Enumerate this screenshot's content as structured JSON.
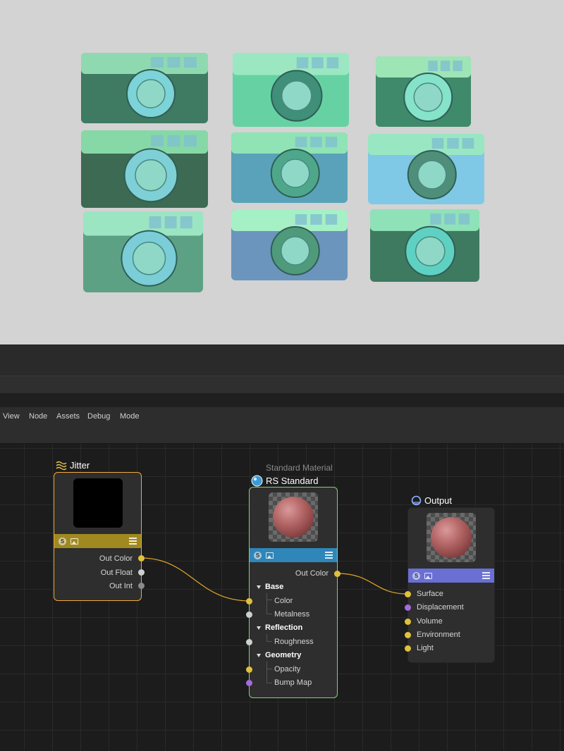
{
  "menu": {
    "items": [
      "View",
      "Node",
      "Assets",
      "Debug",
      "Mode"
    ]
  },
  "nodes": {
    "jitter": {
      "title": "Jitter",
      "icon": "wave-lines-icon",
      "accent": "#f2a93b",
      "bar_color": "#a08a1f",
      "outputs": [
        "Out Color",
        "Out Float",
        "Out Int"
      ]
    },
    "rs_standard": {
      "subtitle": "Standard Material",
      "title": "RS Standard",
      "icon": "sphere-icon",
      "accent": "#7fd07f",
      "bar_color": "#2f86b9",
      "output": "Out Color",
      "groups": [
        {
          "name": "Base",
          "ports": [
            "Color",
            "Metalness"
          ]
        },
        {
          "name": "Reflection",
          "ports": [
            "Roughness"
          ]
        },
        {
          "name": "Geometry",
          "ports": [
            "Opacity",
            "Bump Map"
          ]
        }
      ]
    },
    "output": {
      "title": "Output",
      "icon": "output-ring-icon",
      "bar_color": "#6a6fd3",
      "inputs": [
        "Surface",
        "Displacement",
        "Volume",
        "Environment",
        "Light"
      ]
    }
  },
  "colors": {
    "port_yellow": "#e0c13a",
    "port_grey": "#cfcfcf",
    "port_purple": "#a36be0",
    "wire": "#e0a52a"
  }
}
